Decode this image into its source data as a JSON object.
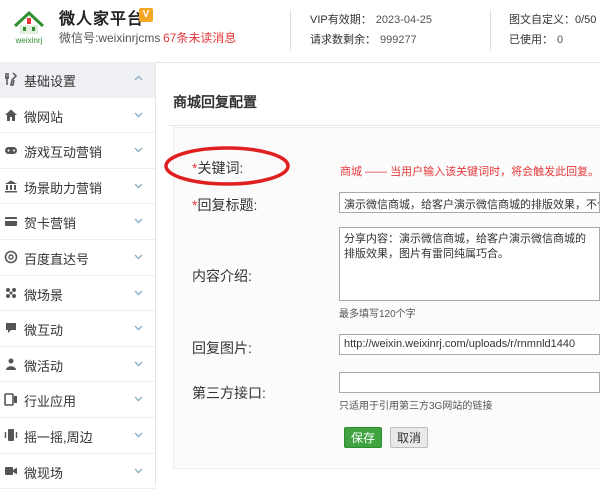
{
  "header": {
    "brand_title": "微人家平台",
    "vip_badge": "V",
    "wechat_id": "微信号:weixinrjcms",
    "unread": "67条未读消息",
    "vip_expiry_label": "VIP有效期：",
    "vip_expiry_value": "2023-04-25",
    "requests_label": "请求数剩余：",
    "requests_value": "999277",
    "graphic_custom_label": "图文自定义：",
    "graphic_custom_value": "0/50",
    "used_label": "已使用：",
    "used_value": "0",
    "logo_text": "weixinrj",
    "logo_small": "微人家"
  },
  "sidebar": {
    "items": [
      {
        "label": "基础设置",
        "icon": "tools-icon"
      },
      {
        "label": "微网站",
        "icon": "home-icon"
      },
      {
        "label": "游戏互动营销",
        "icon": "gamepad-icon"
      },
      {
        "label": "场景助力营销",
        "icon": "bank-icon"
      },
      {
        "label": "贺卡营销",
        "icon": "card-icon"
      },
      {
        "label": "百度直达号",
        "icon": "at-icon"
      },
      {
        "label": "微场景",
        "icon": "scene-icon"
      },
      {
        "label": "微互动",
        "icon": "interact-icon"
      },
      {
        "label": "微活动",
        "icon": "activity-icon"
      },
      {
        "label": "行业应用",
        "icon": "app-icon"
      },
      {
        "label": "摇一摇,周边",
        "icon": "shake-icon"
      },
      {
        "label": "微现场",
        "icon": "video-icon"
      }
    ]
  },
  "main": {
    "title": "商城回复配置",
    "form": {
      "keyword_label": "关键词:",
      "keyword_note": "商城 —— 当用户输入该关键词时，将会触发此回复。",
      "reply_title_label": "回复标题:",
      "reply_title_value": "演示微信商城，给客户演示微信商城的排版效果，不合适",
      "content_label": "内容介绍:",
      "content_value": "分享内容：演示微信商城，给客户演示微信商城的排版效果，图片有雷同纯属巧合。",
      "content_hint": "最多填写120个字",
      "reply_image_label": "回复图片:",
      "reply_image_value": "http://weixin.weixinrj.com/uploads/r/rnmnld1440",
      "third_party_label": "第三方接口:",
      "third_party_value": "",
      "third_party_hint": "只适用于引用第三方3G网站的链接",
      "required_mark": "*"
    },
    "buttons": {
      "save": "保存",
      "cancel": "取消"
    }
  },
  "colors": {
    "accent_red": "#e4393c",
    "save_green": "#3fa33f",
    "logo_green": "#2f8f2f"
  }
}
